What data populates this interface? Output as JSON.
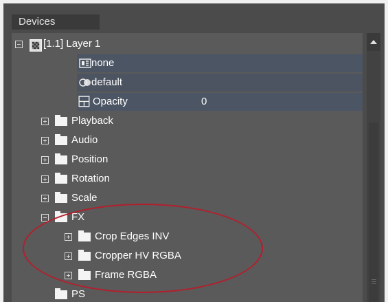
{
  "panel": {
    "tab_label": "Devices"
  },
  "tree": {
    "layer": {
      "label": "[1.1] Layer 1"
    },
    "layer_props": [
      {
        "label": "none",
        "value": "",
        "icon": "mask-icon"
      },
      {
        "label": "default",
        "value": "",
        "icon": "blend-icon"
      },
      {
        "label": "Opacity",
        "value": "0",
        "icon": "opacity-icon"
      }
    ],
    "groups": [
      "Playback",
      "Audio",
      "Position",
      "Rotation",
      "Scale",
      "FX"
    ],
    "fx_items": [
      "Crop Edges INV",
      "Cropper HV RGBA",
      "Frame RGBA"
    ],
    "last_item": "PS"
  },
  "colors": {
    "annotation": "#b21f2d",
    "panel_bg": "#4b4b4b",
    "tree_bg": "#5a5a5a"
  }
}
